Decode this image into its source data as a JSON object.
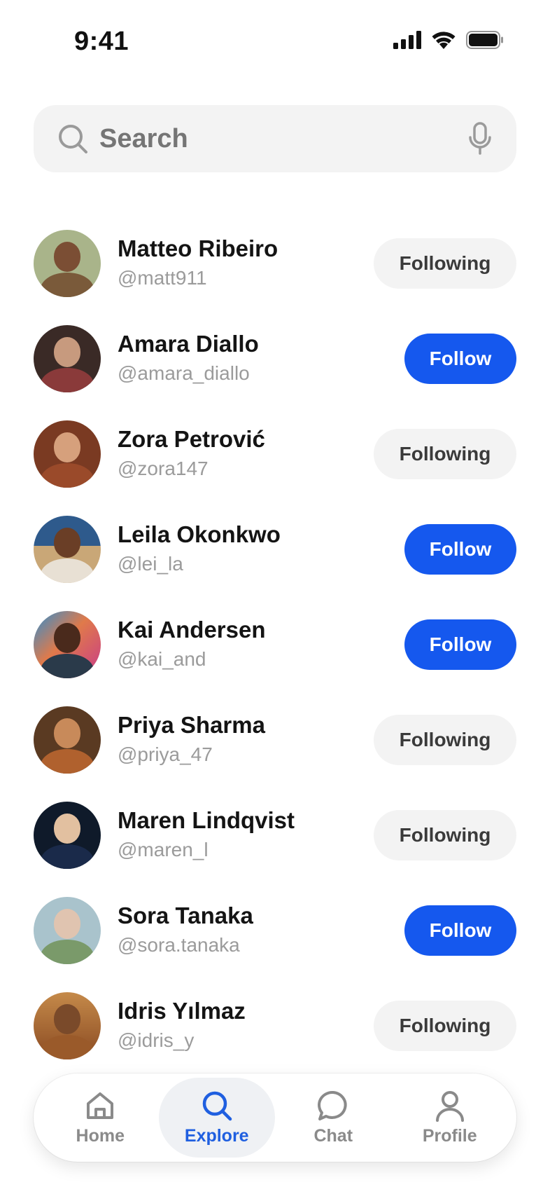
{
  "status_bar": {
    "time": "9:41"
  },
  "search": {
    "placeholder": "Search"
  },
  "users": [
    {
      "name": "Matteo Ribeiro",
      "handle": "@matt911",
      "action": "Following"
    },
    {
      "name": "Amara Diallo",
      "handle": "@amara_diallo",
      "action": "Follow"
    },
    {
      "name": "Zora Petrović",
      "handle": "@zora147",
      "action": "Following"
    },
    {
      "name": "Leila Okonkwo",
      "handle": "@lei_la",
      "action": "Follow"
    },
    {
      "name": "Kai Andersen",
      "handle": "@kai_and",
      "action": "Follow"
    },
    {
      "name": "Priya Sharma",
      "handle": "@priya_47",
      "action": "Following"
    },
    {
      "name": "Maren Lindqvist",
      "handle": "@maren_l",
      "action": "Following"
    },
    {
      "name": "Sora Tanaka",
      "handle": "@sora.tanaka",
      "action": "Follow"
    },
    {
      "name": "Idris Yılmaz",
      "handle": "@idris_y",
      "action": "Following"
    }
  ],
  "tabs": [
    {
      "label": "Home",
      "icon": "home-icon"
    },
    {
      "label": "Explore",
      "icon": "search-icon",
      "active": true
    },
    {
      "label": "Chat",
      "icon": "chat-bubble-icon"
    },
    {
      "label": "Profile",
      "icon": "person-icon"
    }
  ],
  "colors": {
    "accent": "#1558ee",
    "active_tab_text": "#1f5fe0",
    "following_bg": "#f3f3f3",
    "search_bg": "#f3f3f3"
  }
}
